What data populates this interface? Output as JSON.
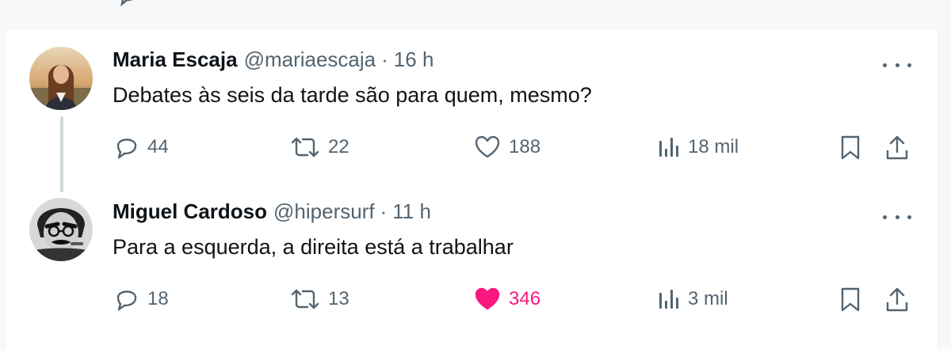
{
  "tweets": [
    {
      "author_name": "Maria Escaja",
      "handle": "@mariaescaja",
      "separator": "·",
      "time": "16 h",
      "text": "Debates às seis da tarde são para quem, mesmo?",
      "replies": "44",
      "reposts": "22",
      "likes": "188",
      "views": "18 mil",
      "liked": false
    },
    {
      "author_name": "Miguel Cardoso",
      "handle": "@hipersurf",
      "separator": "·",
      "time": "11 h",
      "text": "Para a esquerda, a direita está a trabalhar",
      "replies": "18",
      "reposts": "13",
      "likes": "346",
      "views": "3 mil",
      "liked": true
    }
  ],
  "colors": {
    "text_primary": "#0f1419",
    "text_secondary": "#536471",
    "like_active": "#f91880",
    "thread_line": "#cfd9de",
    "border": "#eff3f4"
  },
  "icons": [
    "reply-icon",
    "repost-icon",
    "like-icon",
    "views-icon",
    "bookmark-icon",
    "share-icon",
    "more-icon"
  ]
}
